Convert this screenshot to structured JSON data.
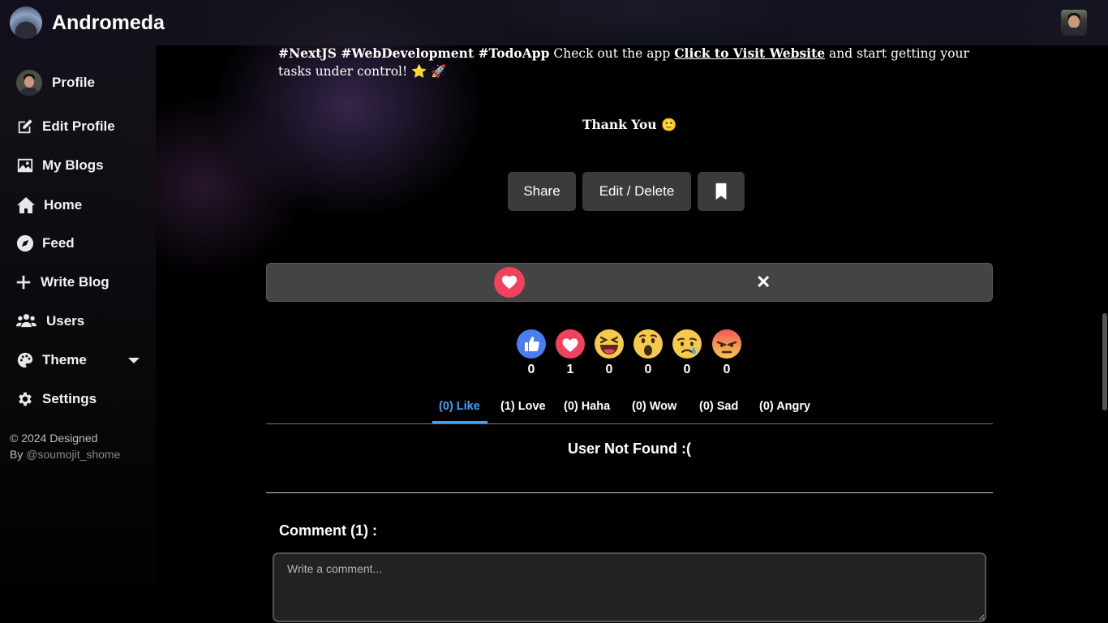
{
  "app": {
    "title": "Andromeda"
  },
  "sidebar": {
    "items": [
      {
        "label": "Profile",
        "icon": "avatar"
      },
      {
        "label": "Edit Profile",
        "icon": "edit-icon"
      },
      {
        "label": "My Blogs",
        "icon": "image-icon"
      },
      {
        "label": "Home",
        "icon": "home-icon"
      },
      {
        "label": "Feed",
        "icon": "compass-icon"
      },
      {
        "label": "Write Blog",
        "icon": "plus-icon"
      },
      {
        "label": "Users",
        "icon": "users-icon"
      },
      {
        "label": "Theme",
        "icon": "palette-icon"
      },
      {
        "label": "Settings",
        "icon": "gear-icon"
      }
    ],
    "footer_line1": "© 2024 Designed",
    "footer_by": "By ",
    "footer_handle": "@soumojit_shome"
  },
  "post": {
    "tags": "#NextJS #WebDevelopment #TodoApp",
    "text_before_link": " Check out the app ",
    "link_text": "Click to Visit Website",
    "text_after_link": " and start getting your tasks under control! ",
    "emojis_end": "⭐ 🚀",
    "thanks": "Thank You 🙂"
  },
  "actions": {
    "share": "Share",
    "edit_delete": "Edit / Delete",
    "bookmark_icon": "bookmark-icon"
  },
  "reaction_bar": {
    "close": "✕"
  },
  "reactions": [
    {
      "name": "like",
      "count": "0"
    },
    {
      "name": "love",
      "count": "1"
    },
    {
      "name": "haha",
      "count": "0"
    },
    {
      "name": "wow",
      "count": "0"
    },
    {
      "name": "sad",
      "count": "0"
    },
    {
      "name": "angry",
      "count": "0"
    }
  ],
  "tabs": [
    {
      "label": "(0) Like",
      "active": true
    },
    {
      "label": "(1) Love",
      "active": false
    },
    {
      "label": "(0) Haha",
      "active": false
    },
    {
      "label": "(0) Wow",
      "active": false
    },
    {
      "label": "(0) Sad",
      "active": false
    },
    {
      "label": "(0) Angry",
      "active": false
    }
  ],
  "user_panel": {
    "message": "User Not Found :("
  },
  "comments": {
    "title": "Comment (1) :",
    "placeholder": "Write a comment..."
  },
  "colors": {
    "accent": "#3ea3f5",
    "love": "#f0425c",
    "button_bg": "#3b3b3b"
  }
}
